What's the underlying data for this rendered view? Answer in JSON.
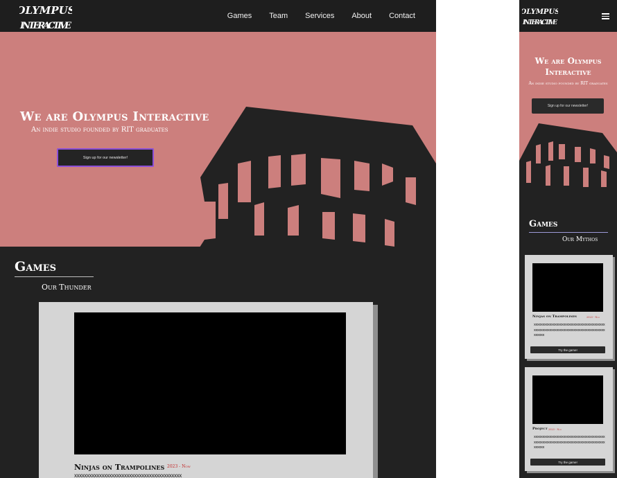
{
  "desktop": {
    "logo": {
      "line1": "OLYMPUS",
      "line2": "INTERACTIVE"
    },
    "nav": {
      "items": [
        "Games",
        "Team",
        "Services",
        "About",
        "Contact"
      ]
    },
    "hero": {
      "title": "We are Olympus Interactive",
      "subtitle": "An indie studio founded by RIT graduates",
      "cta": "Sign up for our newsletter!"
    },
    "games": {
      "heading": "Games",
      "tagline": "Our Thunder",
      "card": {
        "title": "Ninjas on Trampolines",
        "date": "2023 - Now",
        "description": "xxxxxxxxxxxxxxxxxxxxxxxxxxxxxxxxxxxxxxxxxxx"
      }
    }
  },
  "mobile": {
    "logo": {
      "line1": "OLYMPUS",
      "line2": "INTERACTIVE"
    },
    "hero": {
      "title": "We are Olympus Interactive",
      "subtitle": "An indie studio founded by RIT graduates",
      "cta": "Sign up for our newsletter!"
    },
    "games": {
      "heading": "Games",
      "tagline": "Our Mythos",
      "cards": [
        {
          "title": "Ninjas on Trampolines",
          "date": "2023 - Now",
          "description": "xxxxxxxxxxxxxxxxxxxxxxxxxxxxxxxxxxxxxxxxxxxxxxxxxxxxxxxxxxxxxxxxxxxxxxxxxxxxxxxxxxxxxxxx",
          "button": "Try the game!"
        },
        {
          "title": "Project",
          "date": "2023 - Now",
          "description": "xxxxxxxxxxxxxxxxxxxxxxxxxxxxxxxxxxxxxxxxxxxxxxxxxxxxxxxxxxxxxxxxxxxxxxxxxxxxxxxxxxxxxxxx",
          "button": "Try the game!"
        }
      ]
    },
    "menu_icon": "hamburger-icon"
  },
  "colors": {
    "hero_bg": "#cc7f7d",
    "dark_bg": "#222222",
    "card_bg": "#d5d5d5",
    "date_red": "#c32b2b",
    "focus_purple": "#8b4fd8"
  }
}
